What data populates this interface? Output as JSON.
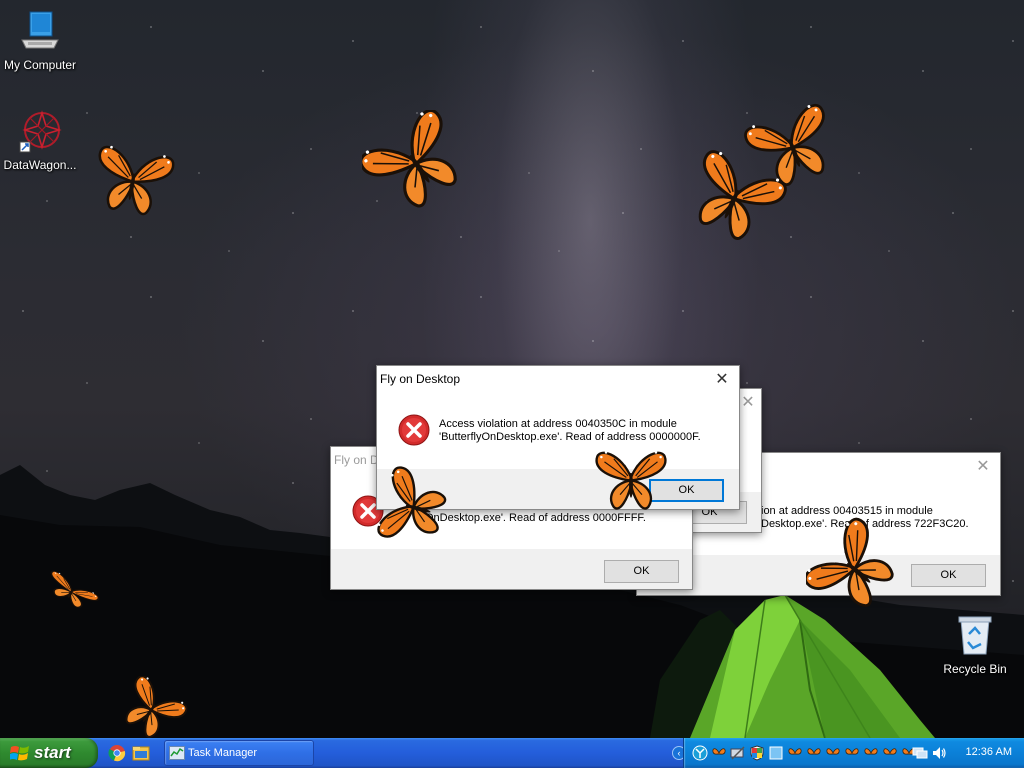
{
  "desktop": {
    "icons": [
      {
        "label": "My Computer"
      },
      {
        "label": "DataWagon..."
      },
      {
        "label": "Recycle Bin"
      }
    ]
  },
  "dialogs": {
    "front": {
      "title": "Fly on Desktop",
      "message_line1": "Access violation at address 0040350C in module",
      "message_line2": "'ButterflyOnDesktop.exe'. Read of address 0000000F.",
      "ok_label": "OK"
    },
    "left": {
      "title": "Fly on D",
      "message_line1": "flyOnDesktop.exe'. Read of address 0000FFFF.",
      "ok_label": "OK"
    },
    "right": {
      "message_line1": "ion at address 00403515 in module",
      "message_line2": "Desktop.exe'. Read of address 722F3C20.",
      "ok_label": "OK"
    },
    "middle": {
      "ok_label": "OK"
    }
  },
  "taskbar": {
    "start_label": "start",
    "task_button_label": "Task Manager",
    "clock": "12:36 AM"
  },
  "colors": {
    "taskbar_blue": "#245edb",
    "start_green": "#2f8a2f",
    "tray_blue": "#0b80d8",
    "error_red": "#d22b2b",
    "butterfly_orange": "#f07b1c",
    "dialog_focus_border": "#0078d7"
  }
}
